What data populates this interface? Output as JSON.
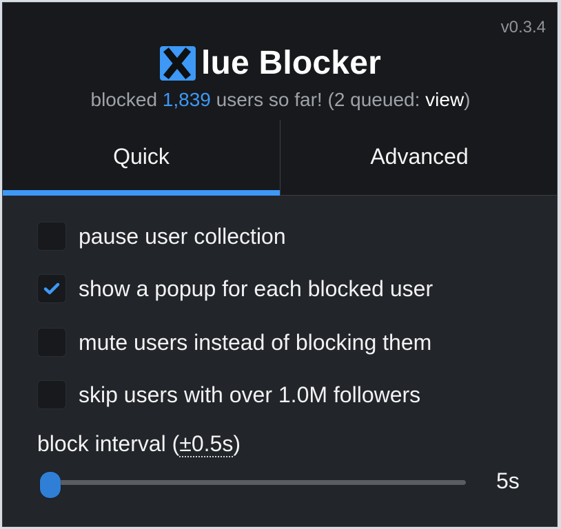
{
  "popup": {
    "version": "v0.3.4",
    "brand": {
      "title_suffix": "lue Blocker"
    },
    "subtitle": {
      "prefix": "blocked ",
      "count": "1,839",
      "middle": " users so far! (2 queued: ",
      "view": "view",
      "suffix": ")"
    },
    "tabs": [
      {
        "label": "Quick",
        "active": true
      },
      {
        "label": "Advanced",
        "active": false
      }
    ],
    "options": [
      {
        "label": "pause user collection",
        "checked": false
      },
      {
        "label": "show a popup for each blocked user",
        "checked": true
      },
      {
        "label": "mute users instead of blocking them",
        "checked": false
      },
      {
        "label": "skip users with over 1.0M followers",
        "checked": false
      }
    ],
    "interval": {
      "label_prefix": "block interval (",
      "label_dotted": "±0.5s",
      "label_suffix": ")",
      "value": "5s"
    }
  },
  "colors": {
    "background": "#17191c",
    "panel": "#22252a",
    "accent": "#3d98f6",
    "text": "#f2f2f2",
    "muted": "#9ea3a9"
  },
  "icons": {
    "logo": "blue-blocker-x-icon",
    "check": "check-icon"
  }
}
